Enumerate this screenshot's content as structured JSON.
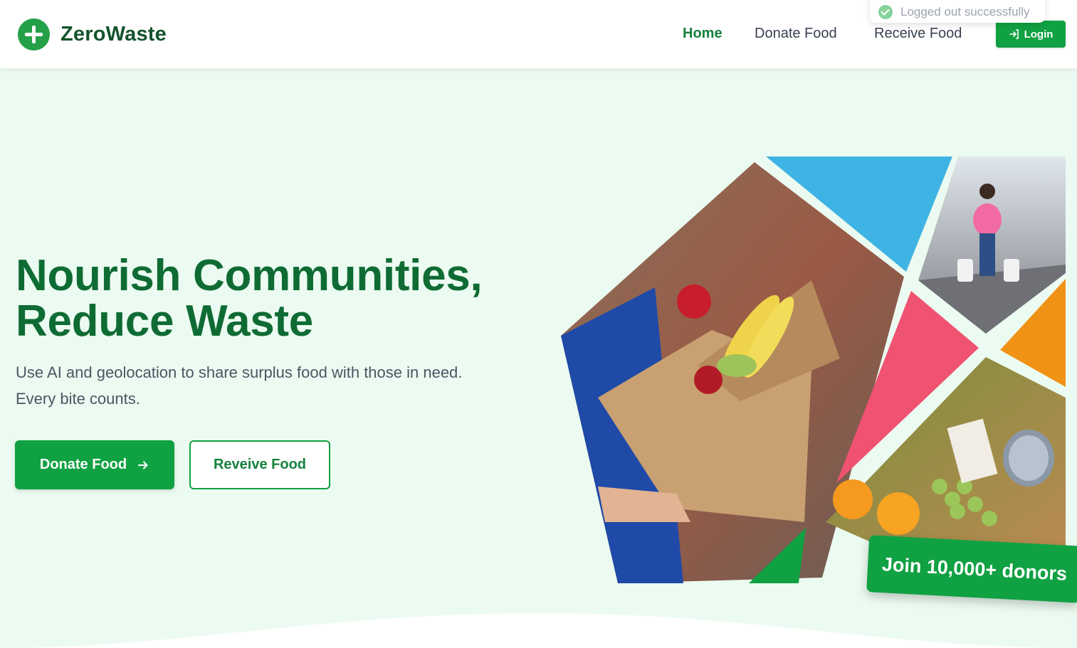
{
  "brand": {
    "name": "ZeroWaste",
    "logo_icon": "plus-circle-icon",
    "color": "#24a148"
  },
  "nav": {
    "home": "Home",
    "donate": "Donate Food",
    "receive": "Receive Food",
    "login": "Login",
    "login_icon": "login-arrow-icon",
    "active": "Home"
  },
  "toast": {
    "message": "Logged out successfully",
    "icon": "check-circle-icon"
  },
  "hero": {
    "title_line1": "Nourish Communities,",
    "title_line2": "Reduce Waste",
    "subtitle_line1": "Use AI and geolocation to share surplus food with those in need.",
    "subtitle_line2": "Every bite counts.",
    "primary_cta": "Donate Food",
    "primary_cta_icon": "arrow-right-icon",
    "secondary_cta": "Reveive Food"
  },
  "collage": {
    "badge": "Join 10,000+ donors",
    "colors": {
      "blue": "#3fb3e3",
      "pink": "#f05272",
      "orange": "#f09216",
      "green": "#10a142"
    }
  },
  "theme": {
    "accent": "#10a142",
    "heading": "#0f6b34",
    "background": "#ecfbf1"
  }
}
